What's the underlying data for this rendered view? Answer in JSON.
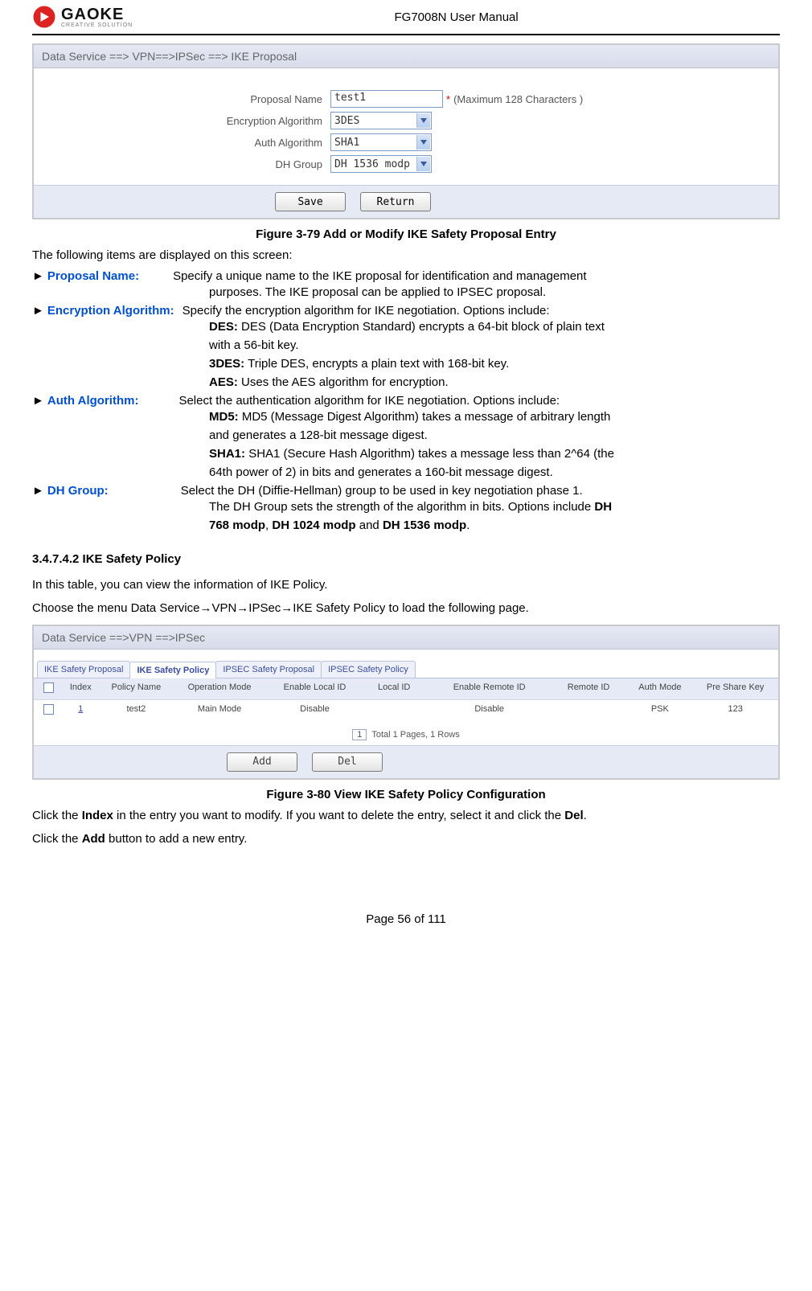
{
  "header": {
    "brand": "GAOKE",
    "brand_sub": "CREATIVE SOLUTION",
    "doc_title": "FG7008N User Manual"
  },
  "shot1": {
    "titlebar": "Data Service ==> VPN==>IPSec ==> IKE Proposal",
    "labels": {
      "proposal_name": "Proposal Name",
      "enc": "Encryption Algorithm",
      "auth": "Auth Algorithm",
      "dh": "DH Group"
    },
    "values": {
      "proposal_name": "test1",
      "enc": "3DES",
      "auth": "SHA1",
      "dh": "DH 1536 modp"
    },
    "hint_star": "*",
    "hint_text": "(Maximum 128 Characters )",
    "buttons": {
      "save": "Save",
      "return": "Return"
    }
  },
  "caption1": "Figure 3-79   Add or Modify IKE Safety Proposal Entry",
  "intro1": "The following items are displayed on this screen:",
  "terms": {
    "proposal_name": {
      "label": "Proposal Name:",
      "line1": "Specify a unique name to the IKE proposal for identification and management",
      "line2": "purposes. The IKE proposal can be applied to IPSEC proposal."
    },
    "enc": {
      "label": "Encryption Algorithm:",
      "line1": "Specify the encryption algorithm for IKE negotiation. Options include:",
      "des_b": "DES:",
      "des_t1": "DES (Data Encryption Standard) encrypts a 64-bit block of plain text",
      "des_t2": "with a 56-bit key.",
      "tdes_b": "3DES:",
      "tdes_t": "Triple DES, encrypts a plain text with 168-bit key.",
      "aes_b": "AES:",
      "aes_t": "Uses the AES algorithm for encryption."
    },
    "auth": {
      "label": "Auth Algorithm:",
      "line1": "Select the authentication algorithm for IKE negotiation. Options include:",
      "md5_b": "MD5:",
      "md5_t1": "MD5 (Message Digest Algorithm) takes a message of arbitrary length",
      "md5_t2": "and generates a 128-bit message digest.",
      "sha_b": "SHA1:",
      "sha_t1": "SHA1 (Secure Hash Algorithm) takes a message less than 2^64 (the",
      "sha_t2": "64th power of 2) in bits and generates a 160-bit message digest."
    },
    "dh": {
      "label": "DH Group:",
      "line1": "Select the DH (Diffie-Hellman) group to be used in key negotiation phase 1.",
      "line2a": "The DH Group sets the strength of the algorithm in bits. Options include ",
      "opt1": "DH",
      "line3a": "768 modp",
      "line3b": ", ",
      "opt2": "DH 1024 modp",
      "line3c": " and ",
      "opt3": "DH 1536 modp",
      "line3d": "."
    }
  },
  "section2": {
    "heading": "3.4.7.4.2 IKE Safety Policy",
    "p1": "In this table, you can view the information of IKE Policy.",
    "p2": "Choose the menu Data Service→VPN→IPSec→IKE Safety Policy to load the following page."
  },
  "shot2": {
    "titlebar": "Data Service ==>VPN ==>IPSec",
    "tabs": {
      "t1": "IKE Safety Proposal",
      "t2": "IKE Safety Policy",
      "t3": "IPSEC Safety Proposal",
      "t4": "IPSEC Safety Policy"
    },
    "cols": {
      "index": "Index",
      "policy": "Policy Name",
      "op": "Operation Mode",
      "eli": "Enable Local ID",
      "lid": "Local ID",
      "eri": "Enable Remote ID",
      "rid": "Remote ID",
      "auth": "Auth Mode",
      "psk": "Pre Share Key"
    },
    "row": {
      "index": "1",
      "policy": "test2",
      "op": "Main Mode",
      "eli": "Disable",
      "lid": "",
      "eri": "Disable",
      "rid": "",
      "auth": "PSK",
      "psk": "123"
    },
    "pager_box": "1",
    "pager_text": "Total 1 Pages, 1 Rows",
    "buttons": {
      "add": "Add",
      "del": "Del"
    }
  },
  "caption2": "Figure 3-80   View IKE Safety Policy Configuration",
  "after_p1a": "Click the ",
  "after_b1": "Index",
  "after_p1b": " in the entry you want to modify. If you want to delete the entry, select it and click the ",
  "after_b2": "Del",
  "after_p1c": ".",
  "after_p2a": "Click the ",
  "after_b3": "Add",
  "after_p2b": " button to add a new entry.",
  "footer": "Page 56 of 111"
}
